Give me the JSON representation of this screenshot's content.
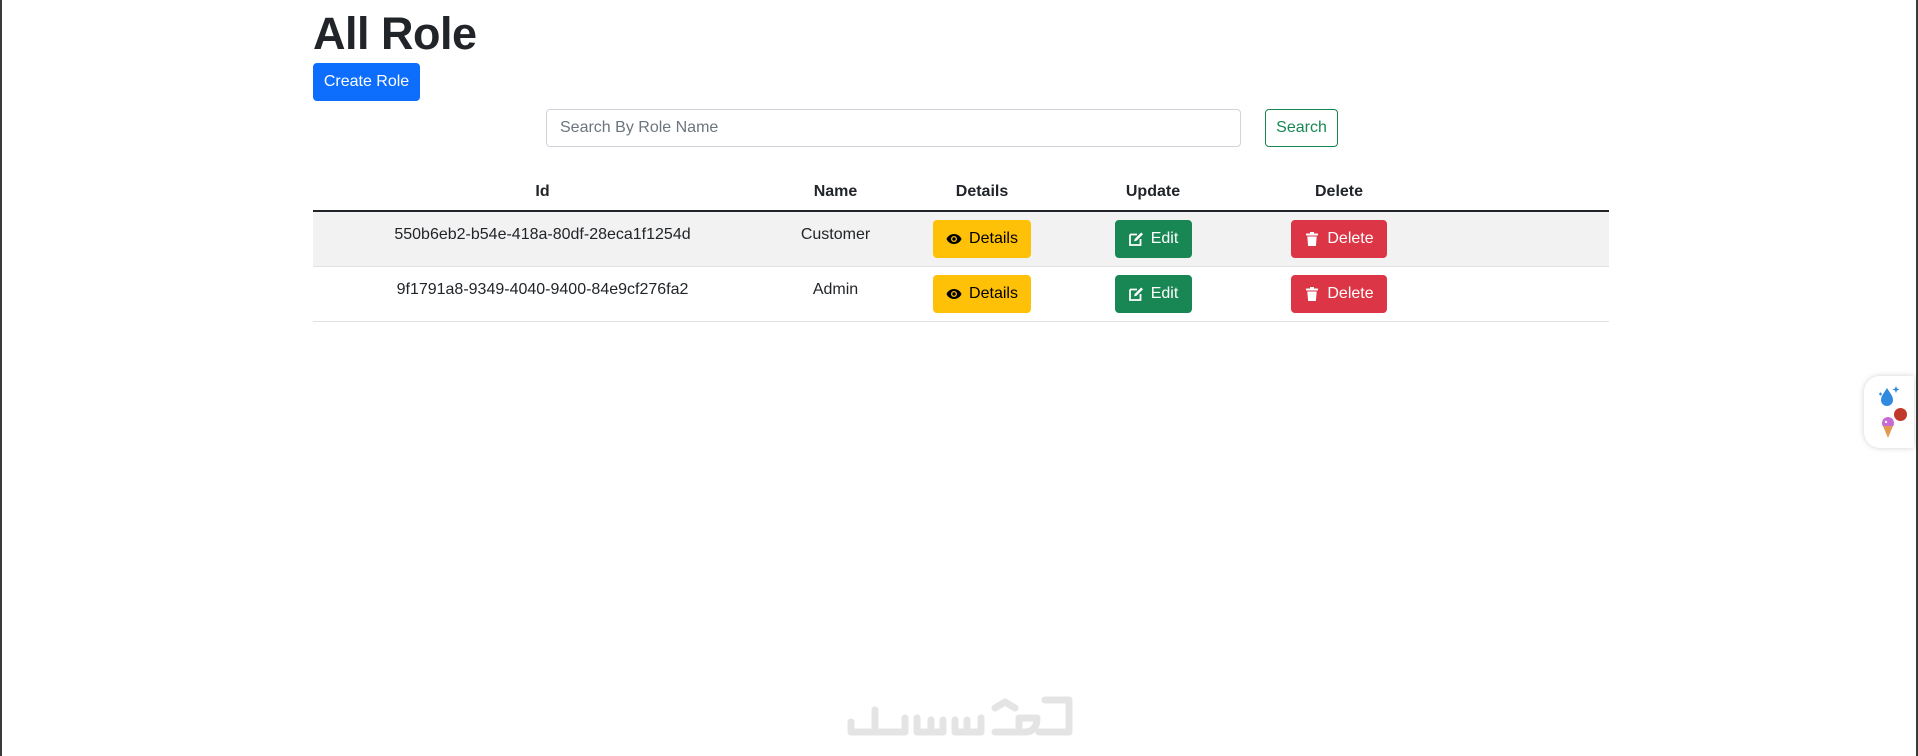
{
  "page": {
    "title": "All Role"
  },
  "toolbar": {
    "create_label": "Create Role"
  },
  "search": {
    "placeholder": "Search By Role Name",
    "value": "",
    "button_label": "Search"
  },
  "table": {
    "headers": [
      "Id",
      "Name",
      "Details",
      "Update",
      "Delete"
    ],
    "rows": [
      {
        "id": "550b6eb2-b54e-418a-80df-28eca1f1254d",
        "name": "Customer",
        "details_label": "Details",
        "edit_label": "Edit",
        "delete_label": "Delete"
      },
      {
        "id": "9f1791a8-9349-4040-9400-84e9cf276fa2",
        "name": "Admin",
        "details_label": "Details",
        "edit_label": "Edit",
        "delete_label": "Delete"
      }
    ]
  },
  "icons": {
    "details": "eye-icon",
    "edit": "edit-icon",
    "delete": "trash-icon"
  },
  "colors": {
    "primary": "#0d6efd",
    "success": "#198754",
    "warning": "#ffc107",
    "danger": "#dc3545"
  }
}
